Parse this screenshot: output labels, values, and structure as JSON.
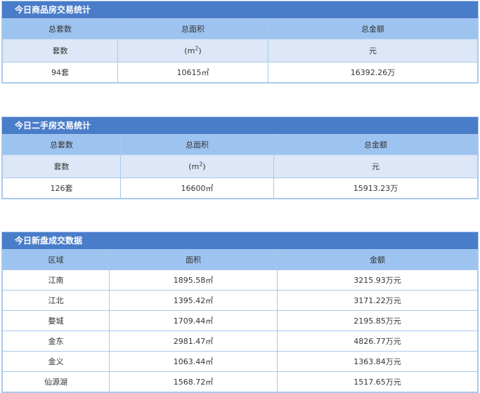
{
  "commercial": {
    "title": "今日商品房交易统计",
    "headers": [
      "总套数",
      "总面积",
      "总金额"
    ],
    "units": {
      "count": "套数",
      "area_base": "(m",
      "area_exp": "2",
      "area_close": ")",
      "amount": "元"
    },
    "values": [
      "94套",
      "10615㎡",
      "16392.26万"
    ]
  },
  "secondhand": {
    "title": "今日二手房交易统计",
    "headers": [
      "总套数",
      "总面积",
      "总金额"
    ],
    "units": {
      "count": "套数",
      "area_base": "(m",
      "area_exp": "2",
      "area_close": ")",
      "amount": "元"
    },
    "values": [
      "126套",
      "16600㎡",
      "15913.23万"
    ]
  },
  "newhomes": {
    "title": "今日新盘成交数据",
    "headers": [
      "区域",
      "面积",
      "金额"
    ],
    "rows": [
      [
        "江南",
        "1895.58㎡",
        "3215.93万元"
      ],
      [
        "江北",
        "1395.42㎡",
        "3171.22万元"
      ],
      [
        "婺城",
        "1709.44㎡",
        "2195.85万元"
      ],
      [
        "金东",
        "2981.47㎡",
        "4826.77万元"
      ],
      [
        "金义",
        "1063.44㎡",
        "1363.84万元"
      ],
      [
        "仙源湖",
        "1568.72㎡",
        "1517.65万元"
      ]
    ]
  },
  "colors": {
    "title_bar": "#4a7dc9",
    "header_bg": "#9dc3f0",
    "subheader_bg": "#dde7f7",
    "border": "#a9c9ec"
  }
}
